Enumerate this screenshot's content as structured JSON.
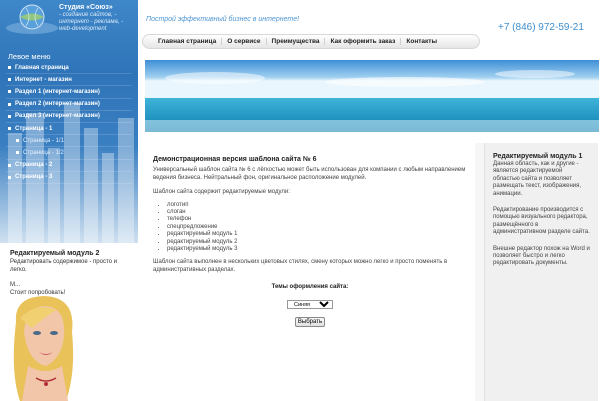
{
  "brand": {
    "name": "Студия «Союз»",
    "tagline": "- создание сайтов, - интернет - реклама, - web-development",
    "slogan": "Построй эффективный бизнес в интернете!",
    "phone": "+7 (846) 972-59-21"
  },
  "top_nav": [
    {
      "label": "Главная страница"
    },
    {
      "label": "О сервисе"
    },
    {
      "label": "Преимущества"
    },
    {
      "label": "Как оформить заказ"
    },
    {
      "label": "Контакты"
    }
  ],
  "left_menu": {
    "title": "Левое меню",
    "items": [
      {
        "label": "Главная страница",
        "sub": false
      },
      {
        "label": "Интернет - магазин",
        "sub": false
      },
      {
        "label": "Раздел 1 (интернет-магазин)",
        "sub": false
      },
      {
        "label": "Раздел 2 (интернет-магазин)",
        "sub": false
      },
      {
        "label": "Раздел 3 (интернет-магазин)",
        "sub": false
      },
      {
        "label": "Страница - 1",
        "sub": false
      },
      {
        "label": "Страница - 1/1",
        "sub": true
      },
      {
        "label": "Страница - 1/2",
        "sub": true
      },
      {
        "label": "Страница - 2",
        "sub": false
      },
      {
        "label": "Страница - 3",
        "sub": false
      }
    ]
  },
  "module2": {
    "title": "Редактируемый модуль 2",
    "text1": "Редактировать содержимое - просто и легко.",
    "text2": "М...",
    "text3": "Стоит попробовать!"
  },
  "main": {
    "title": "Демонстрационная версия шаблона сайта № 6",
    "intro": "Универсальный шаблон сайта № 6 с лёгкостью может быть использован для компании с любым направлением ведения бизнеса. Нейтральный фон, оригинальное расположение модулей.",
    "modules_intro": "Шаблон сайта содержит редактируемые модули:",
    "modules": [
      "логотип",
      "слоган",
      "телефон",
      "спецпредложение",
      "редактируемый модуль 1",
      "редактируемый модуль 2",
      "редактируемый модуль 3"
    ],
    "styles_note": "Шаблон сайта выполнен в нескольких цветовых стилях, смену которых можно легко и просто поменять в административных разделах.",
    "theme_label": "Темы оформления сайта:",
    "theme_value": "Синяя",
    "select_button": "Выбрать"
  },
  "module1": {
    "title": "Редактируемый модуль 1",
    "p1": "Данная область, как и другие - является редактируемой областью сайта и позволяет размещать текст, изображения, анимации.",
    "p2": "Редактирование производится с помощью визуального редактора, размещённого в административном разделе сайта.",
    "p3": "Внешне редактор похож на Word и позволяет быстро и легко редактировать документы."
  },
  "colors": {
    "accent_blue": "#3e87c9",
    "slogan_blue": "#4e96d2"
  }
}
